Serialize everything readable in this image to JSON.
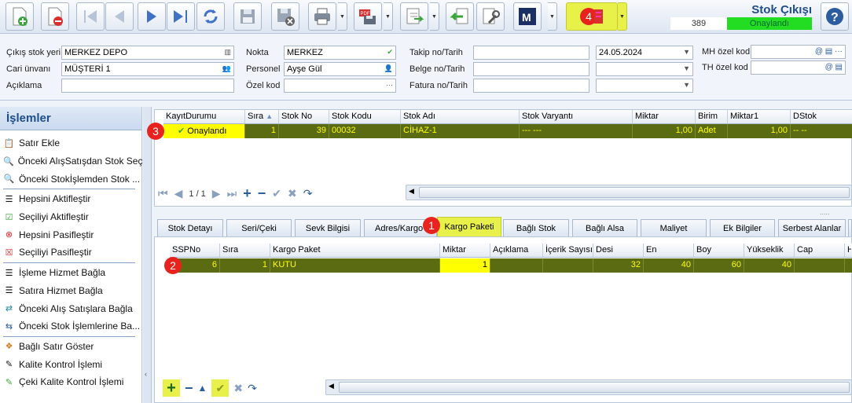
{
  "header": {
    "title": "Stok Çıkışı",
    "doc_number": "389",
    "status": "Onaylandı"
  },
  "toolbar": {
    "badge": "4"
  },
  "form": {
    "cikis_stok_yeri_label": "Çıkış stok yeri",
    "cikis_stok_yeri": "MERKEZ DEPO",
    "cari_unvani_label": "Cari ünvanı",
    "cari_unvani": "MÜŞTERİ 1",
    "aciklama_label": "Açıklama",
    "aciklama": "",
    "nokta_label": "Nokta",
    "nokta": "MERKEZ",
    "personel_label": "Personel",
    "personel": "Ayşe Gül",
    "ozel_kod_label": "Özel kod",
    "ozel_kod": "",
    "takip_label": "Takip no/Tarih",
    "takip_no": "",
    "takip_tarih": "24.05.2024",
    "belge_label": "Belge no/Tarih",
    "belge_no": "",
    "belge_tarih": "",
    "fatura_label": "Fatura no/Tarih",
    "fatura_no": "",
    "fatura_tarih": "",
    "mh_label": "MH özel kod",
    "mh": "",
    "th_label": "TH özel kod",
    "th": ""
  },
  "sidebar": {
    "title": "İşlemler",
    "items": [
      {
        "label": "Satır Ekle"
      },
      {
        "label": "Önceki AlışSatışdan Stok Seç"
      },
      {
        "label": "Önceki Stokİşlemden Stok ..."
      },
      {
        "label": "Hepsini Aktifleştir"
      },
      {
        "label": "Seçiliyi Aktifleştir"
      },
      {
        "label": "Hepsini Pasifleştir"
      },
      {
        "label": "Seçiliyi Pasifleştir"
      },
      {
        "label": "İşleme Hizmet Bağla"
      },
      {
        "label": "Satıra Hizmet Bağla"
      },
      {
        "label": "Önceki Alış Satışlara Bağla"
      },
      {
        "label": "Önceki Stok İşlemlerine Ba..."
      },
      {
        "label": "Bağlı Satır Göster"
      },
      {
        "label": "Kalite Kontrol İşlemi"
      },
      {
        "label": "Çeki Kalite Kontrol İşlemi"
      }
    ]
  },
  "top_grid": {
    "columns": [
      "KayıtDurumu",
      "Sıra",
      "Stok No",
      "Stok Kodu",
      "Stok Adı",
      "Stok Varyantı",
      "Miktar",
      "Birim",
      "Miktar1",
      "DStok"
    ],
    "row": {
      "kayit": "Onaylandı",
      "sira": "1",
      "stok_no": "39",
      "stok_kodu": "00032",
      "stok_adi": "CİHAZ-1",
      "varyant": "--- ---",
      "miktar": "1,00",
      "birim": "Adet",
      "miktar1": "1,00",
      "dstok": "-- --"
    },
    "pager": "1 / 1",
    "badge": "3"
  },
  "tabs": [
    {
      "label": "Stok Detayı"
    },
    {
      "label": "Seri/Çeki"
    },
    {
      "label": "Sevk Bilgisi"
    },
    {
      "label": "Adres/Kargo"
    },
    {
      "label": "Kargo Paketi"
    },
    {
      "label": "Bağlı Stok"
    },
    {
      "label": "Bağlı Alsa"
    },
    {
      "label": "Maliyet"
    },
    {
      "label": "Ek Bilgiler"
    },
    {
      "label": "Serbest Alanlar"
    }
  ],
  "tab_badge": "1",
  "bottom_grid": {
    "columns": [
      "SSPNo",
      "Sıra",
      "Kargo Paket",
      "Miktar",
      "Açıklama",
      "İçerik Sayısı",
      "Desi",
      "En",
      "Boy",
      "Yükseklik",
      "Cap",
      "H"
    ],
    "row": {
      "sspno": "6",
      "sira": "1",
      "kargo_paket": "KUTU",
      "miktar": "1",
      "aciklama": "",
      "icerik": "",
      "desi": "32",
      "en": "40",
      "boy": "60",
      "yukseklik": "40",
      "cap": ""
    },
    "badge": "2"
  },
  "colors": {
    "accent": "#1f4e8c",
    "row_bg": "#5a6b12",
    "row_text": "#ffff00",
    "status_green": "#22dd22",
    "highlight": "#e8f04a",
    "badge": "#e8231d"
  }
}
